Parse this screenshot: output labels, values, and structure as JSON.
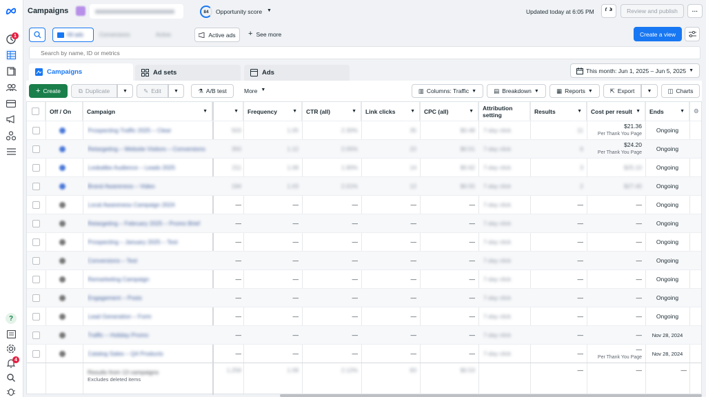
{
  "header": {
    "title": "Campaigns",
    "opportunity_score_value": "84",
    "opportunity_score_label": "Opportunity score",
    "updated_text": "Updated today at 6:05 PM",
    "review_publish_label": "Review and publish",
    "more_label": "···"
  },
  "filters": {
    "pill_1": "All ads",
    "pill_2": "Conversions",
    "pill_3": "Active",
    "active_ads_label": "Active ads",
    "see_more_label": "See more",
    "create_view_label": "Create a view"
  },
  "search": {
    "placeholder": "Search by name, ID or metrics"
  },
  "tabs": {
    "campaigns": "Campaigns",
    "ad_sets": "Ad sets",
    "ads": "Ads"
  },
  "date_range": {
    "label": "This month: Jun 1, 2025 – Jun 5, 2025"
  },
  "toolbar": {
    "create": "Create",
    "duplicate": "Duplicate",
    "edit": "Edit",
    "ab_test": "A/B test",
    "more": "More",
    "columns": "Columns: Traffic",
    "breakdown": "Breakdown",
    "reports": "Reports",
    "export": "Export",
    "charts": "Charts"
  },
  "columns": {
    "off_on": "Off / On",
    "campaign": "Campaign",
    "frequency": "Frequency",
    "ctr": "CTR (all)",
    "link_clicks": "Link clicks",
    "cpc": "CPC (all)",
    "attribution": "Attribution setting",
    "results": "Results",
    "cost_per_result": "Cost per result",
    "ends": "Ends"
  },
  "colors": {
    "accent": "#1877f2",
    "create_green": "#1a7f4b",
    "badge_red": "#e41e3f"
  },
  "rows": [
    {
      "campaign": "Prospecting Traffic 2025 – Clear",
      "c1": "503",
      "freq": "1.05",
      "ctr": "2.30%",
      "clicks": "35",
      "cpc": "$0.48",
      "attr": "7-day click",
      "results": "11",
      "cost": "$21.36",
      "cost_sub": "Per Thank You Page",
      "ends": "Ongoing",
      "dot": "#4a78d8"
    },
    {
      "campaign": "Retargeting – Website Visitors – Conversions",
      "c1": "350",
      "freq": "1.12",
      "ctr": "2.05%",
      "clicks": "22",
      "cpc": "$0.51",
      "attr": "7-day click",
      "results": "6",
      "cost": "$24.20",
      "cost_sub": "Per Thank You Page",
      "ends": "Ongoing",
      "dot": "#4a78d8"
    },
    {
      "campaign": "Lookalike Audience – Leads 2025",
      "c1": "211",
      "freq": "1.08",
      "ctr": "1.90%",
      "clicks": "14",
      "cpc": "$0.62",
      "attr": "7-day click",
      "results": "3",
      "cost": "$25.10",
      "cost_sub": "",
      "ends": "Ongoing",
      "dot": "#4a78d8"
    },
    {
      "campaign": "Brand Awareness – Video",
      "c1": "194",
      "freq": "1.03",
      "ctr": "2.01%",
      "clicks": "12",
      "cpc": "$0.55",
      "attr": "7-day click",
      "results": "2",
      "cost": "$27.40",
      "cost_sub": "",
      "ends": "Ongoing",
      "dot": "#4a78d8"
    },
    {
      "campaign": "Local Awareness Campaign 2024",
      "c1": "—",
      "freq": "—",
      "ctr": "—",
      "clicks": "—",
      "cpc": "—",
      "attr": "7-day click",
      "results": "—",
      "cost": "—",
      "cost_sub": "",
      "ends": "Ongoing",
      "dot": "#777"
    },
    {
      "campaign": "Retargeting – February 2025 – Promo Brief",
      "c1": "—",
      "freq": "—",
      "ctr": "—",
      "clicks": "—",
      "cpc": "—",
      "attr": "7-day click",
      "results": "—",
      "cost": "—",
      "cost_sub": "",
      "ends": "Ongoing",
      "dot": "#777"
    },
    {
      "campaign": "Prospecting – January 2025 – Test",
      "c1": "—",
      "freq": "—",
      "ctr": "—",
      "clicks": "—",
      "cpc": "—",
      "attr": "7-day click",
      "results": "—",
      "cost": "—",
      "cost_sub": "",
      "ends": "Ongoing",
      "dot": "#777"
    },
    {
      "campaign": "Conversions – Test",
      "c1": "—",
      "freq": "—",
      "ctr": "—",
      "clicks": "—",
      "cpc": "—",
      "attr": "7-day click",
      "results": "—",
      "cost": "—",
      "cost_sub": "",
      "ends": "Ongoing",
      "dot": "#777"
    },
    {
      "campaign": "Remarketing Campaign",
      "c1": "—",
      "freq": "—",
      "ctr": "—",
      "clicks": "—",
      "cpc": "—",
      "attr": "7-day click",
      "results": "—",
      "cost": "—",
      "cost_sub": "",
      "ends": "Ongoing",
      "dot": "#777"
    },
    {
      "campaign": "Engagement – Posts",
      "c1": "—",
      "freq": "—",
      "ctr": "—",
      "clicks": "—",
      "cpc": "—",
      "attr": "7-day click",
      "results": "—",
      "cost": "—",
      "cost_sub": "",
      "ends": "Ongoing",
      "dot": "#777"
    },
    {
      "campaign": "Lead Generation – Form",
      "c1": "—",
      "freq": "—",
      "ctr": "—",
      "clicks": "—",
      "cpc": "—",
      "attr": "7-day click",
      "results": "—",
      "cost": "—",
      "cost_sub": "",
      "ends": "Ongoing",
      "dot": "#777"
    },
    {
      "campaign": "Traffic – Holiday Promo",
      "c1": "—",
      "freq": "—",
      "ctr": "—",
      "clicks": "—",
      "cpc": "—",
      "attr": "7-day click",
      "results": "—",
      "cost": "—",
      "cost_sub": "",
      "ends": "Nov 28, 2024",
      "dot": "#777"
    },
    {
      "campaign": "Catalog Sales – Q4 Products",
      "c1": "—",
      "freq": "—",
      "ctr": "—",
      "clicks": "—",
      "cpc": "—",
      "attr": "7-day click",
      "results": "—",
      "cost": "—",
      "cost_sub": "Per Thank You Page",
      "ends": "Nov 28, 2024",
      "dot": "#777"
    }
  ],
  "footer": {
    "results_label": "Results from 13 campaigns",
    "excludes": "Excludes deleted items",
    "c1": "1,258",
    "freq": "1.08",
    "ctr": "2.12%",
    "clicks": "83",
    "cpc": "$0.53",
    "results": "—",
    "cost": "—",
    "ends": "—"
  }
}
